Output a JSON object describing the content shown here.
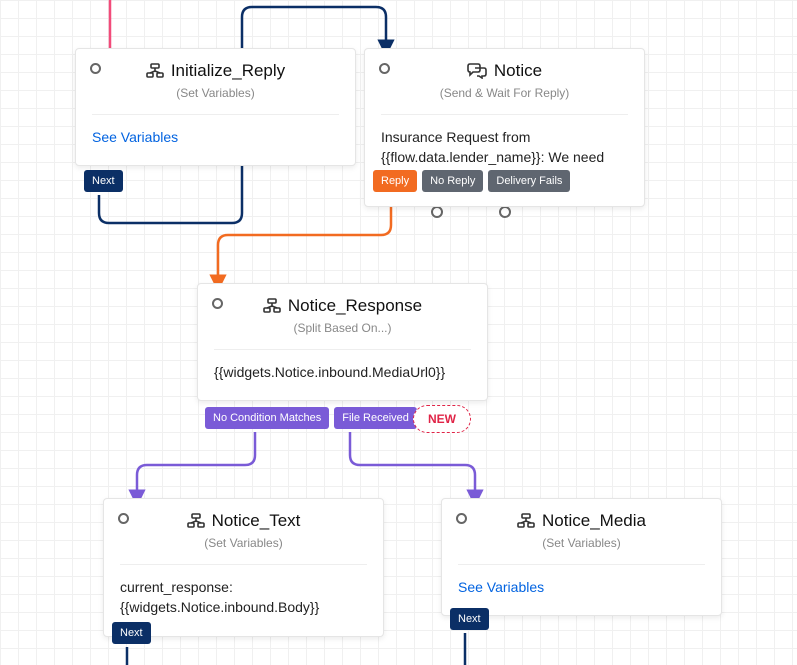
{
  "nodes": {
    "init": {
      "title": "Initialize_Reply",
      "subtitle": "(Set Variables)",
      "body": "See Variables",
      "next": "Next"
    },
    "notice": {
      "title": "Notice",
      "subtitle": "(Send & Wait For Reply)",
      "body": "Insurance Request from {{flow.data.lender_name}}: We need some",
      "reply": "Reply",
      "noreply": "No Reply",
      "delfail": "Delivery Fails"
    },
    "resp": {
      "title": "Notice_Response",
      "subtitle": "(Split Based On...)",
      "body": "{{widgets.Notice.inbound.MediaUrl0}}",
      "nomatch": "No Condition Matches",
      "filerec": "File Received",
      "newlabel": "NEW"
    },
    "ntext": {
      "title": "Notice_Text",
      "subtitle": "(Set Variables)",
      "body": "current_response: {{widgets.Notice.inbound.Body}}",
      "next": "Next"
    },
    "nmedia": {
      "title": "Notice_Media",
      "subtitle": "(Set Variables)",
      "body": "See Variables",
      "next": "Next"
    }
  }
}
